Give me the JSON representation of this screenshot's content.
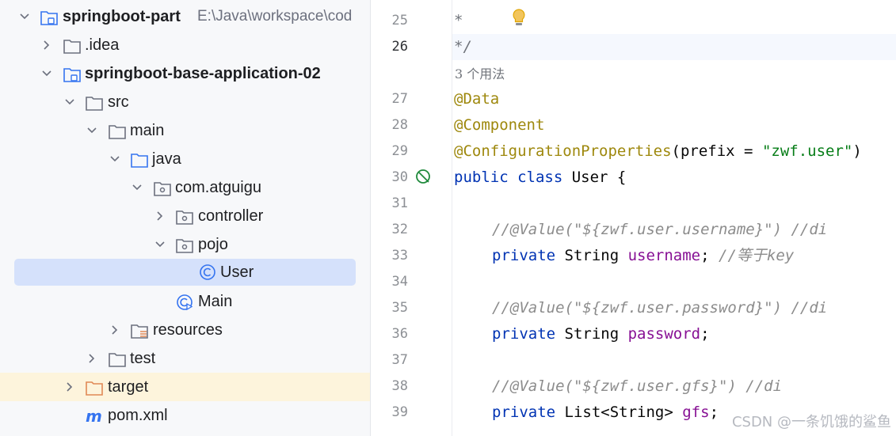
{
  "project_tree": {
    "root": {
      "name": "springboot-part",
      "path": "E:\\Java\\workspace\\cod"
    },
    "items": [
      {
        "label": ".idea"
      },
      {
        "label": "springboot-base-application-02"
      },
      {
        "label": "src"
      },
      {
        "label": "main"
      },
      {
        "label": "java"
      },
      {
        "label": "com.atguigu"
      },
      {
        "label": "controller"
      },
      {
        "label": "pojo"
      },
      {
        "label": "User"
      },
      {
        "label": "Main"
      },
      {
        "label": "resources"
      },
      {
        "label": "test"
      },
      {
        "label": "target"
      },
      {
        "label": "pom.xml"
      }
    ],
    "selected": "User"
  },
  "editor": {
    "current_line": "26",
    "line_numbers": [
      "25",
      "26",
      "27",
      "28",
      "29",
      "30",
      "31",
      "32",
      "33",
      "34",
      "35",
      "36",
      "37",
      "38",
      "39"
    ],
    "usages_hint": "3 个用法",
    "lines": {
      "l25": {
        "star": "*"
      },
      "l26": {
        "close": "*/"
      },
      "l27": {
        "ann": "@Data"
      },
      "l28": {
        "ann": "@Component"
      },
      "l29": {
        "ann": "@ConfigurationProperties",
        "open": "(prefix = ",
        "str": "\"zwf.user\"",
        "close": ")"
      },
      "l30": {
        "kw": "public class",
        "rest": " User {"
      },
      "l32": {
        "comment": "//@Value(\"${zwf.user.username}\") //di"
      },
      "l33": {
        "kw": "private",
        "type": " String ",
        "field": "username",
        "semi": "; ",
        "comment": "//等于key"
      },
      "l35": {
        "comment": "//@Value(\"${zwf.user.password}\") //di"
      },
      "l36": {
        "kw": "private",
        "type": " String ",
        "field": "password",
        "semi": ";"
      },
      "l38": {
        "comment": "//@Value(\"${zwf.user.gfs}\") //di"
      },
      "l39": {
        "kw": "private",
        "type": " List<String> ",
        "field": "gfs",
        "semi": ";"
      }
    },
    "icons": {
      "intention": "lightbulb-icon",
      "gutter": "bean-icon"
    }
  },
  "watermark": "CSDN @一条饥饿的鲨鱼",
  "colors": {
    "selection": "#d5e1fb",
    "excluded_highlight": "#fdf4dc",
    "keyword": "#0033b3",
    "annotation": "#9e880d",
    "string": "#067d17",
    "field": "#871094",
    "comment": "#8c8c8c"
  }
}
